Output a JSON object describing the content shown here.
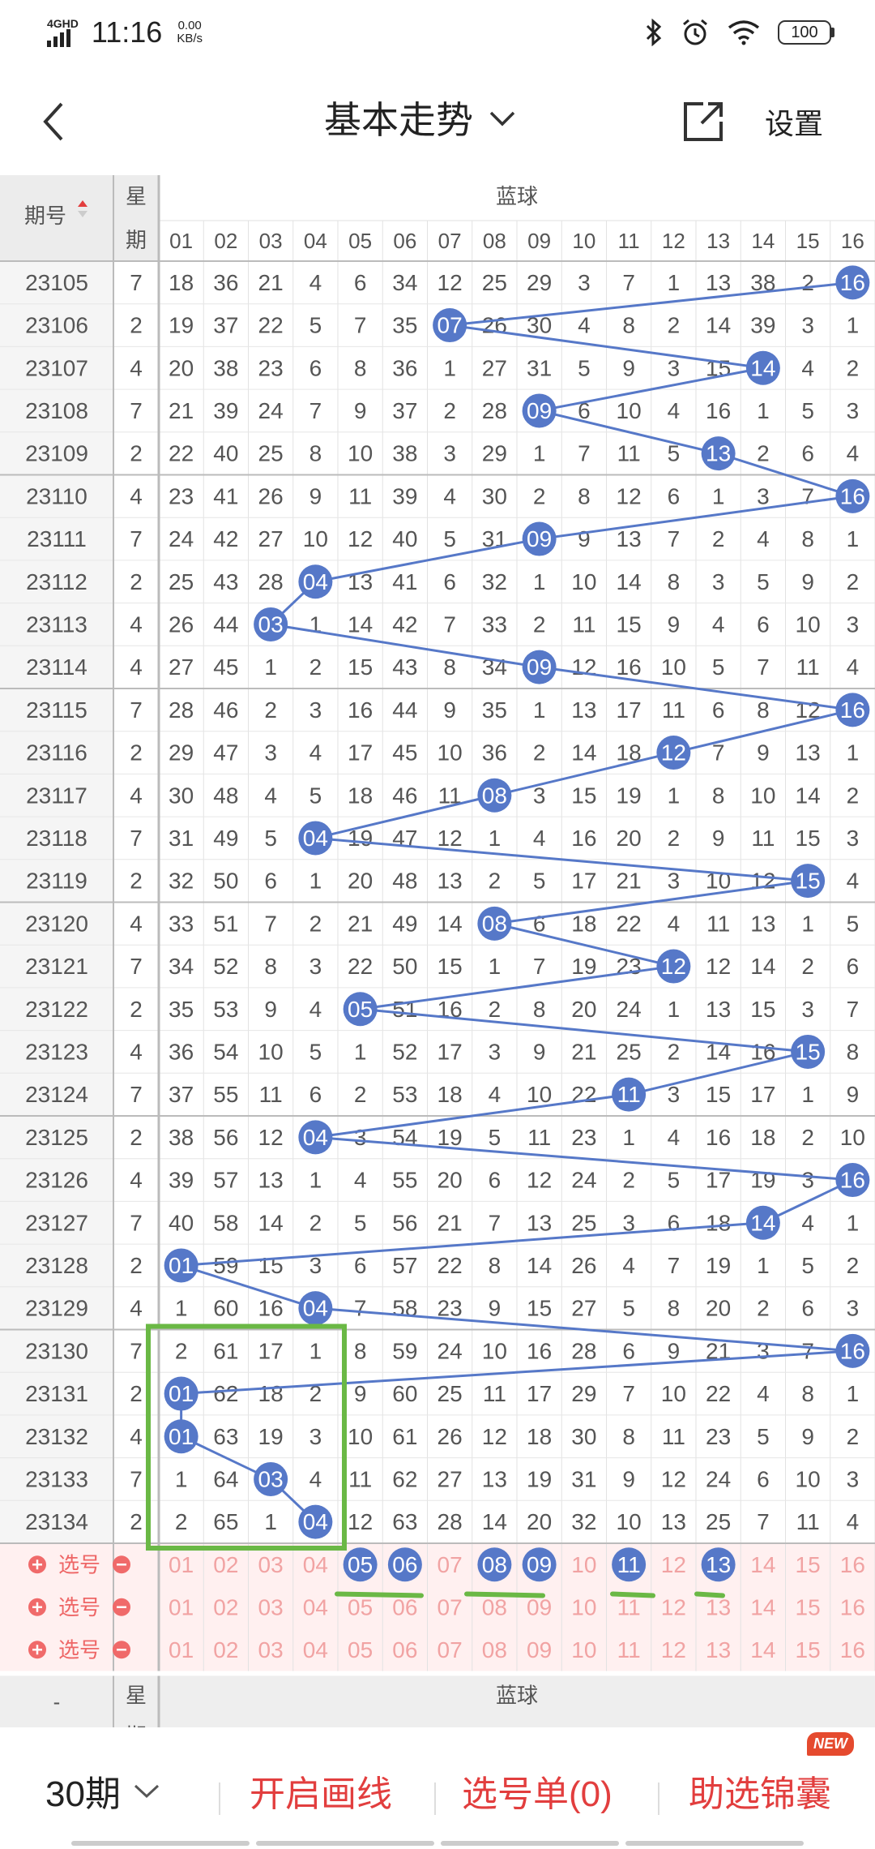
{
  "status_bar": {
    "network": "4GHD",
    "time": "11:16",
    "speed_value": "0.00",
    "speed_unit": "KB/s",
    "battery": "100",
    "icons": [
      "bluetooth-icon",
      "alarm-icon",
      "wifi-icon"
    ]
  },
  "header": {
    "title": "基本走势",
    "settings_label": "设置",
    "icons": [
      "back-arrow-icon",
      "chevron-down-icon",
      "share-icon"
    ]
  },
  "table": {
    "period_header": "期号",
    "week_header_top": "星",
    "week_header_bottom": "期",
    "blue_header": "蓝球",
    "columns": [
      "01",
      "02",
      "03",
      "04",
      "05",
      "06",
      "07",
      "08",
      "09",
      "10",
      "11",
      "12",
      "13",
      "14",
      "15",
      "16"
    ],
    "rows": [
      {
        "period": "23105",
        "week": "7",
        "blue": 16,
        "cells": [
          "18",
          "36",
          "21",
          "4",
          "6",
          "34",
          "12",
          "25",
          "29",
          "3",
          "7",
          "1",
          "13",
          "38",
          "2",
          "16"
        ]
      },
      {
        "period": "23106",
        "week": "2",
        "blue": 7,
        "cells": [
          "19",
          "37",
          "22",
          "5",
          "7",
          "35",
          "07",
          "26",
          "30",
          "4",
          "8",
          "2",
          "14",
          "39",
          "3",
          "1"
        ]
      },
      {
        "period": "23107",
        "week": "4",
        "blue": 14,
        "cells": [
          "20",
          "38",
          "23",
          "6",
          "8",
          "36",
          "1",
          "27",
          "31",
          "5",
          "9",
          "3",
          "15",
          "14",
          "4",
          "2"
        ]
      },
      {
        "period": "23108",
        "week": "7",
        "blue": 9,
        "cells": [
          "21",
          "39",
          "24",
          "7",
          "9",
          "37",
          "2",
          "28",
          "09",
          "6",
          "10",
          "4",
          "16",
          "1",
          "5",
          "3"
        ]
      },
      {
        "period": "23109",
        "week": "2",
        "blue": 13,
        "cells": [
          "22",
          "40",
          "25",
          "8",
          "10",
          "38",
          "3",
          "29",
          "1",
          "7",
          "11",
          "5",
          "13",
          "2",
          "6",
          "4"
        ]
      },
      {
        "period": "23110",
        "week": "4",
        "blue": 16,
        "cells": [
          "23",
          "41",
          "26",
          "9",
          "11",
          "39",
          "4",
          "30",
          "2",
          "8",
          "12",
          "6",
          "1",
          "3",
          "7",
          "16"
        ]
      },
      {
        "period": "23111",
        "week": "7",
        "blue": 9,
        "cells": [
          "24",
          "42",
          "27",
          "10",
          "12",
          "40",
          "5",
          "31",
          "09",
          "9",
          "13",
          "7",
          "2",
          "4",
          "8",
          "1"
        ]
      },
      {
        "period": "23112",
        "week": "2",
        "blue": 4,
        "cells": [
          "25",
          "43",
          "28",
          "04",
          "13",
          "41",
          "6",
          "32",
          "1",
          "10",
          "14",
          "8",
          "3",
          "5",
          "9",
          "2"
        ]
      },
      {
        "period": "23113",
        "week": "4",
        "blue": 3,
        "cells": [
          "26",
          "44",
          "03",
          "1",
          "14",
          "42",
          "7",
          "33",
          "2",
          "11",
          "15",
          "9",
          "4",
          "6",
          "10",
          "3"
        ]
      },
      {
        "period": "23114",
        "week": "4",
        "blue": 9,
        "cells": [
          "27",
          "45",
          "1",
          "2",
          "15",
          "43",
          "8",
          "34",
          "09",
          "12",
          "16",
          "10",
          "5",
          "7",
          "11",
          "4"
        ]
      },
      {
        "period": "23115",
        "week": "7",
        "blue": 16,
        "cells": [
          "28",
          "46",
          "2",
          "3",
          "16",
          "44",
          "9",
          "35",
          "1",
          "13",
          "17",
          "11",
          "6",
          "8",
          "12",
          "16"
        ]
      },
      {
        "period": "23116",
        "week": "2",
        "blue": 12,
        "cells": [
          "29",
          "47",
          "3",
          "4",
          "17",
          "45",
          "10",
          "36",
          "2",
          "14",
          "18",
          "12",
          "7",
          "9",
          "13",
          "1"
        ]
      },
      {
        "period": "23117",
        "week": "4",
        "blue": 8,
        "cells": [
          "30",
          "48",
          "4",
          "5",
          "18",
          "46",
          "11",
          "08",
          "3",
          "15",
          "19",
          "1",
          "8",
          "10",
          "14",
          "2"
        ]
      },
      {
        "period": "23118",
        "week": "7",
        "blue": 4,
        "cells": [
          "31",
          "49",
          "5",
          "04",
          "19",
          "47",
          "12",
          "1",
          "4",
          "16",
          "20",
          "2",
          "9",
          "11",
          "15",
          "3"
        ]
      },
      {
        "period": "23119",
        "week": "2",
        "blue": 15,
        "cells": [
          "32",
          "50",
          "6",
          "1",
          "20",
          "48",
          "13",
          "2",
          "5",
          "17",
          "21",
          "3",
          "10",
          "12",
          "15",
          "4"
        ]
      },
      {
        "period": "23120",
        "week": "4",
        "blue": 8,
        "cells": [
          "33",
          "51",
          "7",
          "2",
          "21",
          "49",
          "14",
          "08",
          "6",
          "18",
          "22",
          "4",
          "11",
          "13",
          "1",
          "5"
        ]
      },
      {
        "period": "23121",
        "week": "7",
        "blue": 12,
        "cells": [
          "34",
          "52",
          "8",
          "3",
          "22",
          "50",
          "15",
          "1",
          "7",
          "19",
          "23",
          "12",
          "12",
          "14",
          "2",
          "6"
        ]
      },
      {
        "period": "23122",
        "week": "2",
        "blue": 5,
        "cells": [
          "35",
          "53",
          "9",
          "4",
          "05",
          "51",
          "16",
          "2",
          "8",
          "20",
          "24",
          "1",
          "13",
          "15",
          "3",
          "7"
        ]
      },
      {
        "period": "23123",
        "week": "4",
        "blue": 15,
        "cells": [
          "36",
          "54",
          "10",
          "5",
          "1",
          "52",
          "17",
          "3",
          "9",
          "21",
          "25",
          "2",
          "14",
          "16",
          "15",
          "8"
        ]
      },
      {
        "period": "23124",
        "week": "7",
        "blue": 11,
        "cells": [
          "37",
          "55",
          "11",
          "6",
          "2",
          "53",
          "18",
          "4",
          "10",
          "22",
          "11",
          "3",
          "15",
          "17",
          "1",
          "9"
        ]
      },
      {
        "period": "23125",
        "week": "2",
        "blue": 4,
        "cells": [
          "38",
          "56",
          "12",
          "04",
          "3",
          "54",
          "19",
          "5",
          "11",
          "23",
          "1",
          "4",
          "16",
          "18",
          "2",
          "10"
        ]
      },
      {
        "period": "23126",
        "week": "4",
        "blue": 16,
        "cells": [
          "39",
          "57",
          "13",
          "1",
          "4",
          "55",
          "20",
          "6",
          "12",
          "24",
          "2",
          "5",
          "17",
          "19",
          "3",
          "16"
        ]
      },
      {
        "period": "23127",
        "week": "7",
        "blue": 14,
        "cells": [
          "40",
          "58",
          "14",
          "2",
          "5",
          "56",
          "21",
          "7",
          "13",
          "25",
          "3",
          "6",
          "18",
          "14",
          "4",
          "1"
        ]
      },
      {
        "period": "23128",
        "week": "2",
        "blue": 1,
        "cells": [
          "01",
          "59",
          "15",
          "3",
          "6",
          "57",
          "22",
          "8",
          "14",
          "26",
          "4",
          "7",
          "19",
          "1",
          "5",
          "2"
        ]
      },
      {
        "period": "23129",
        "week": "4",
        "blue": 4,
        "cells": [
          "1",
          "60",
          "16",
          "04",
          "7",
          "58",
          "23",
          "9",
          "15",
          "27",
          "5",
          "8",
          "20",
          "2",
          "6",
          "3"
        ]
      },
      {
        "period": "23130",
        "week": "7",
        "blue": 16,
        "cells": [
          "2",
          "61",
          "17",
          "1",
          "8",
          "59",
          "24",
          "10",
          "16",
          "28",
          "6",
          "9",
          "21",
          "3",
          "7",
          "16"
        ]
      },
      {
        "period": "23131",
        "week": "2",
        "blue": 1,
        "cells": [
          "01",
          "62",
          "18",
          "2",
          "9",
          "60",
          "25",
          "11",
          "17",
          "29",
          "7",
          "10",
          "22",
          "4",
          "8",
          "1"
        ]
      },
      {
        "period": "23132",
        "week": "4",
        "blue": 1,
        "cells": [
          "01",
          "63",
          "19",
          "3",
          "10",
          "61",
          "26",
          "12",
          "18",
          "30",
          "8",
          "11",
          "23",
          "5",
          "9",
          "2"
        ]
      },
      {
        "period": "23133",
        "week": "7",
        "blue": 3,
        "cells": [
          "1",
          "64",
          "03",
          "4",
          "11",
          "62",
          "27",
          "13",
          "19",
          "31",
          "9",
          "12",
          "24",
          "6",
          "10",
          "3"
        ]
      },
      {
        "period": "23134",
        "week": "2",
        "blue": 4,
        "cells": [
          "2",
          "65",
          "1",
          "04",
          "12",
          "63",
          "28",
          "14",
          "20",
          "32",
          "10",
          "13",
          "25",
          "7",
          "11",
          "4"
        ]
      }
    ],
    "selector_label": "选号",
    "selector_rows": [
      {
        "selected": [
          "05",
          "06",
          "08",
          "09",
          "11",
          "13"
        ]
      },
      {
        "selected": []
      },
      {
        "selected": []
      }
    ],
    "footer_period": "-"
  },
  "colors": {
    "ball_blue": "#5678c8",
    "line_blue": "#5678c8",
    "highlight_green": "#6ab845",
    "selector_bg": "#fff0f0",
    "accent_red": "#e23e3e"
  },
  "bottom_bar": {
    "period_count": "30期",
    "draw_line_label": "开启画线",
    "selection_list_label": "选号单(0)",
    "helper_label": "助选锦囊",
    "new_badge": "NEW"
  }
}
